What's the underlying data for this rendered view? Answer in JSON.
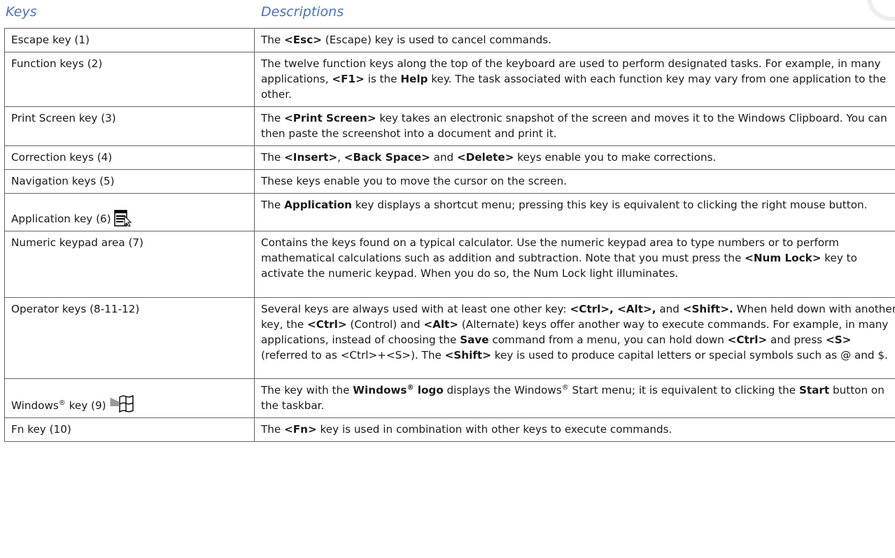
{
  "header": {
    "keys_label": "Keys",
    "descriptions_label": "Descriptions"
  },
  "rows": [
    {
      "key": "Escape key (1)",
      "desc": [
        {
          "t": "The "
        },
        {
          "t": "<Esc>",
          "b": true
        },
        {
          "t": " (Escape) key is used to cancel commands."
        }
      ]
    },
    {
      "key": "Function keys (2)",
      "desc": [
        {
          "t": "The twelve function keys along the top of the keyboard are used to perform designated tasks. For example, in many applications, "
        },
        {
          "t": "<F1>",
          "b": true
        },
        {
          "t": " is the "
        },
        {
          "t": "Help",
          "b": true
        },
        {
          "t": " key. The task associated with each function key may vary from one application to the other."
        }
      ]
    },
    {
      "key": "Print Screen key (3)",
      "desc": [
        {
          "t": "The "
        },
        {
          "t": "<Print Screen>",
          "b": true
        },
        {
          "t": " key takes an electronic snapshot of the screen and moves it to the Windows Clipboard. You can then paste the screenshot into a document and print it."
        }
      ]
    },
    {
      "key": "Correction keys (4)",
      "desc": [
        {
          "t": "The "
        },
        {
          "t": "<Insert>",
          "b": true
        },
        {
          "t": ", "
        },
        {
          "t": "<Back Space>",
          "b": true
        },
        {
          "t": " and "
        },
        {
          "t": "<Delete>",
          "b": true
        },
        {
          "t": " keys enable you to make corrections."
        }
      ]
    },
    {
      "key": "Navigation keys (5)",
      "desc": [
        {
          "t": "These keys enable you to move the cursor on the screen."
        }
      ]
    },
    {
      "key": "Application key (6)",
      "icon": "application-key-icon",
      "desc": [
        {
          "t": "The "
        },
        {
          "t": "Application",
          "b": true
        },
        {
          "t": " key displays a shortcut menu; pressing this key is equivalent to clicking the right mouse button."
        }
      ]
    },
    {
      "key": "Numeric keypad area (7)",
      "desc": [
        {
          "t": "Contains the keys found on a typical calculator. Use the numeric keypad area to type numbers or to perform mathematical calculations such as addition and subtraction. Note that you must press the "
        },
        {
          "t": "<Num Lock>",
          "b": true
        },
        {
          "t": " key to activate the numeric keypad. When you do so, the Num Lock light illuminates."
        }
      ]
    },
    {
      "key": "Operator keys (8-11-12)",
      "desc": [
        {
          "t": "Several keys are always used with at least one other key: "
        },
        {
          "t": "<Ctrl>, <Alt>,",
          "b": true
        },
        {
          "t": " and "
        },
        {
          "t": "<Shift>.",
          "b": true
        },
        {
          "t": " When held down with another key, the "
        },
        {
          "t": "<Ctrl>",
          "b": true
        },
        {
          "t": " (Control) and "
        },
        {
          "t": "<Alt>",
          "b": true
        },
        {
          "t": " (Alternate) keys offer another way to execute commands. For example, in many applications, instead of choosing the "
        },
        {
          "t": "Save",
          "b": true
        },
        {
          "t": " command from a menu, you can hold down "
        },
        {
          "t": "<Ctrl>",
          "b": true
        },
        {
          "t": " and press "
        },
        {
          "t": "<S>",
          "b": true
        },
        {
          "t": " (referred to as <Ctrl>+<S>). The "
        },
        {
          "t": "<Shift>",
          "b": true
        },
        {
          "t": " key is used to produce capital letters or special symbols such as @ and $."
        }
      ]
    },
    {
      "key": "Windows",
      "key_sup": "®",
      "key_after": " key (9)",
      "icon": "windows-logo-icon",
      "desc": [
        {
          "t": "The key with the "
        },
        {
          "t": "Windows",
          "b": true
        },
        {
          "t": "®",
          "b": true,
          "sup": true
        },
        {
          "t": " logo",
          "b": true
        },
        {
          "t": " displays the Windows"
        },
        {
          "t": "®",
          "sup": true
        },
        {
          "t": " Start menu; it is equivalent to clicking the "
        },
        {
          "t": "Start",
          "b": true
        },
        {
          "t": " button on the taskbar."
        }
      ]
    },
    {
      "key": "Fn key (10)",
      "desc": [
        {
          "t": "The "
        },
        {
          "t": "<Fn>",
          "b": true
        },
        {
          "t": " key is used in combination with other keys to execute commands."
        }
      ]
    }
  ]
}
